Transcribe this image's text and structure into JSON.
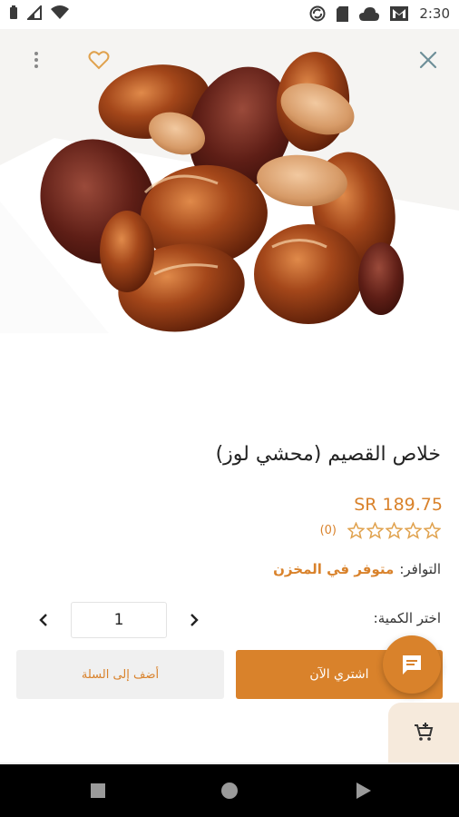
{
  "status_bar": {
    "time": "2:30",
    "icons": [
      "battery-icon",
      "signal-icon",
      "wifi-icon",
      "sync-icon",
      "sd-card-icon",
      "cloud-icon",
      "gmail-icon"
    ]
  },
  "hero": {
    "image_subject": "product-photo-dates-stuffed-with-almonds",
    "icons": [
      "close-icon",
      "heart-icon",
      "more-vertical-icon"
    ]
  },
  "product": {
    "title": "خلاص القصيم (محشي لوز)",
    "price": "SR 189.75",
    "rating_count": "(0)",
    "rating_value": 0,
    "rating_max": 5,
    "availability_label": "التوافر:",
    "availability_value": "متوفر في المخزن"
  },
  "quantity": {
    "label": "اختر الكمية:",
    "value": "1"
  },
  "actions": {
    "buy_now": "اشتري الآن",
    "add_to_cart": "أضف إلى السلة"
  },
  "fab": {
    "chat_icon": "chat-icon",
    "cart_icon": "add-cart-icon"
  },
  "colors": {
    "accent": "#d9822b",
    "secondary_button": "#f0f0f0",
    "text": "#222222"
  }
}
